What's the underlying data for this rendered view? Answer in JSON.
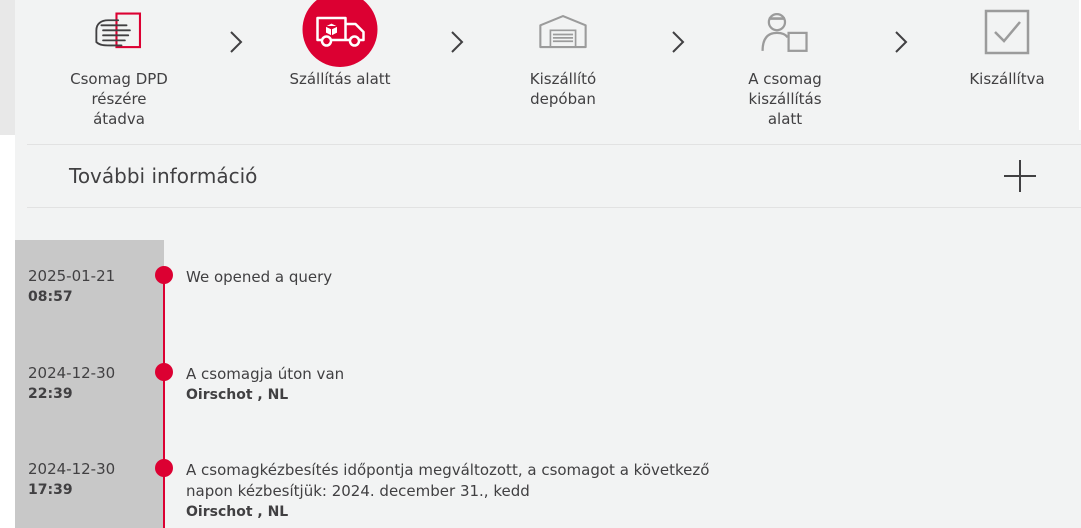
{
  "steps": [
    {
      "label": "Csomag DPD\nrészére\nátadva",
      "icon": "parcel-handover-icon"
    },
    {
      "label": "Szállítás alatt",
      "icon": "delivery-van-icon",
      "active": true
    },
    {
      "label": "Kiszállító\ndepóban",
      "icon": "depot-icon"
    },
    {
      "label": "A csomag\nkiszállítás\nalatt",
      "icon": "courier-icon"
    },
    {
      "label": "Kiszállítva",
      "icon": "delivered-check-icon"
    }
  ],
  "more_info": {
    "title": "További információ",
    "icon": "plus-icon"
  },
  "events": [
    {
      "date": "2025-01-21",
      "time": "08:57",
      "text": "We opened a query",
      "location": ""
    },
    {
      "date": "2024-12-30",
      "time": "22:39",
      "text": "A csomagja úton van",
      "location": "Oirschot , NL"
    },
    {
      "date": "2024-12-30",
      "time": "17:39",
      "text": "A csomagkézbesítés időpontja megváltozott, a csomagot a következő napon kézbesítjük: 2024. december 31., kedd",
      "location": "Oirschot , NL"
    }
  ],
  "colors": {
    "accent": "#dc0032",
    "icon_gray": "#9b9b9b",
    "text": "#414042",
    "background": "#f2f3f3"
  }
}
